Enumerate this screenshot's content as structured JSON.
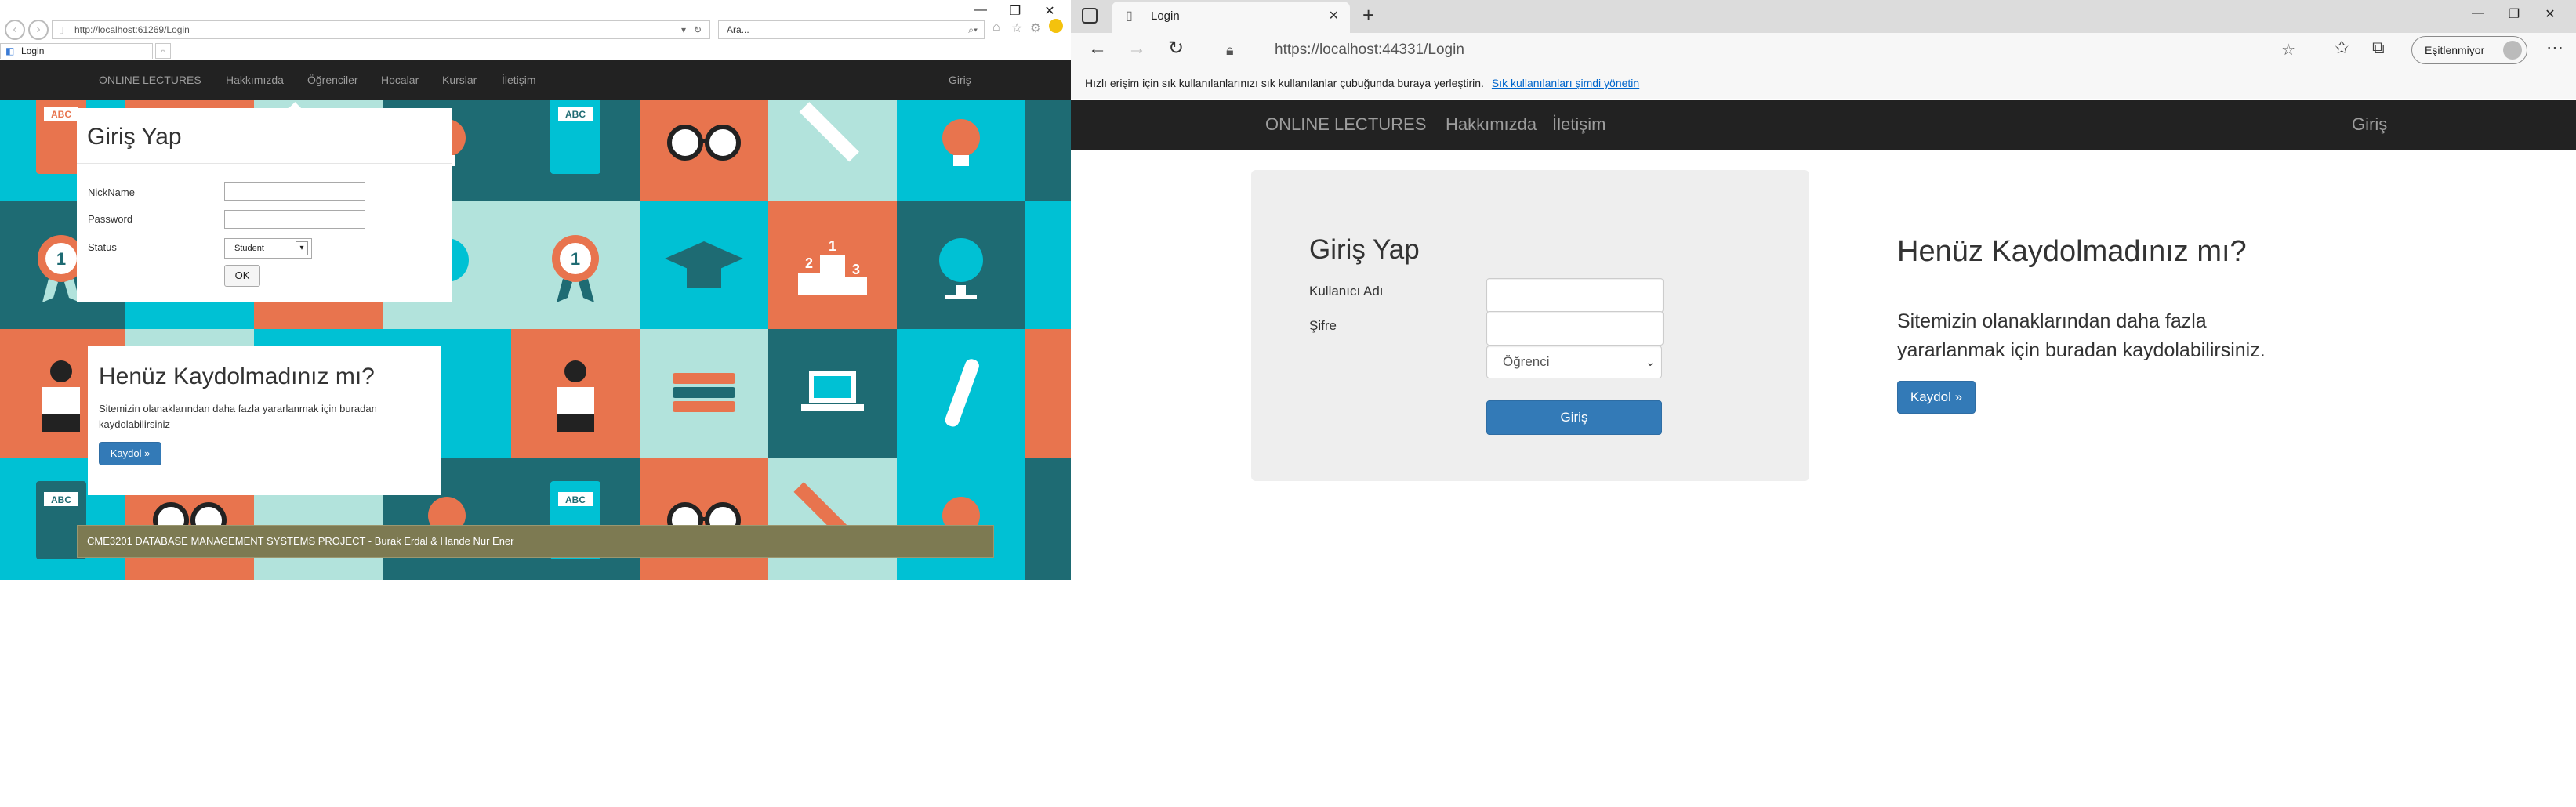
{
  "left_window": {
    "address": "http://localhost:61269/Login",
    "search_placeholder": "Ara...",
    "tab_title": "Login",
    "controls": {
      "minimize": "—",
      "restore": "❐",
      "close": "✕"
    },
    "nav": {
      "brand": "ONLINE LECTURES",
      "items": [
        "Hakkımızda",
        "Öğrenciler",
        "Hocalar",
        "Kurslar",
        "İletişim"
      ],
      "login": "Giriş"
    },
    "login_card": {
      "title": "Giriş Yap",
      "nickname_label": "NickName",
      "password_label": "Password",
      "status_label": "Status",
      "status_value": "Student",
      "ok_button": "OK"
    },
    "register_card": {
      "title": "Henüz Kaydolmadınız mı?",
      "text": "Sitemizin olanaklarından daha fazla yararlanmak için buradan kaydolabilirsiniz",
      "button": "Kaydol »"
    },
    "footer": "CME3201 DATABASE MANAGEMENT SYSTEMS PROJECT - Burak Erdal & Hande Nur Ener",
    "tile_labels": {
      "abc": "ABC",
      "medal": "1",
      "podium_first": "1",
      "podium_second": "2",
      "podium_third": "3"
    }
  },
  "right_window": {
    "tab_title": "Login",
    "new_tab": "+",
    "address": "https://localhost:44331/Login",
    "profile_label": "Eşitlenmiyor",
    "controls": {
      "minimize": "—",
      "restore": "❐",
      "close": "✕"
    },
    "favbar_text": "Hızlı erişim için sık kullanılanlarınızı sık kullanılanlar çubuğunda buraya yerleştirin.",
    "favbar_link": "Sık kullanılanları şimdi yönetin",
    "nav": {
      "brand": "ONLINE LECTURES",
      "items": [
        "Hakkımızda",
        "İletişim"
      ],
      "login": "Giriş"
    },
    "login_card": {
      "title": "Giriş Yap",
      "username_label": "Kullanıcı Adı",
      "password_label": "Şifre",
      "role_value": "Öğrenci",
      "submit_button": "Giriş"
    },
    "register": {
      "title": "Henüz Kaydolmadınız mı?",
      "text": "Sitemizin olanaklarından daha fazla yararlanmak için buradan kaydolabilirsiniz.",
      "button": "Kaydol »"
    }
  },
  "colors": {
    "teal": "#00c1d4",
    "dark_teal": "#1e6b73",
    "orange": "#e8744e",
    "mint": "#b2e3dc",
    "navbar": "#222222",
    "primary": "#337ab7"
  }
}
